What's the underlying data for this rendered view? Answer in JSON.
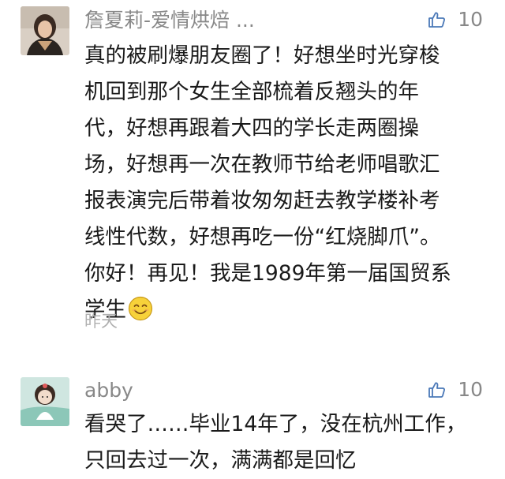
{
  "comments": [
    {
      "author": "詹夏莉-爱情烘焙 ...",
      "likes": "10",
      "lines": [
        "真的被刷爆朋友圈了！好想坐时光穿梭",
        "机回到那个女生全部梳着反翘头的年",
        "代，好想再跟着大四的学长走两圈操",
        "场，好想再一次在教师节给老师唱歌汇",
        "报表演完后带着妆匆匆赶去教学楼补考",
        "线性代数，好想再吃一份“红烧脚爪”。",
        "你好！再见！我是1989年第一届国贸系",
        "学生"
      ],
      "emoji": "smiling-face",
      "timestamp": "昨天"
    },
    {
      "author": "abby",
      "likes": "10",
      "lines": [
        "看哭了……毕业14年了，没在杭州工作，",
        "只回去过一次，满满都是回忆"
      ]
    }
  ],
  "colors": {
    "meta_gray": "#888888",
    "text": "#1a1a1a",
    "timestamp": "#b0b0b0",
    "emoji_face": "#f7d23a"
  }
}
